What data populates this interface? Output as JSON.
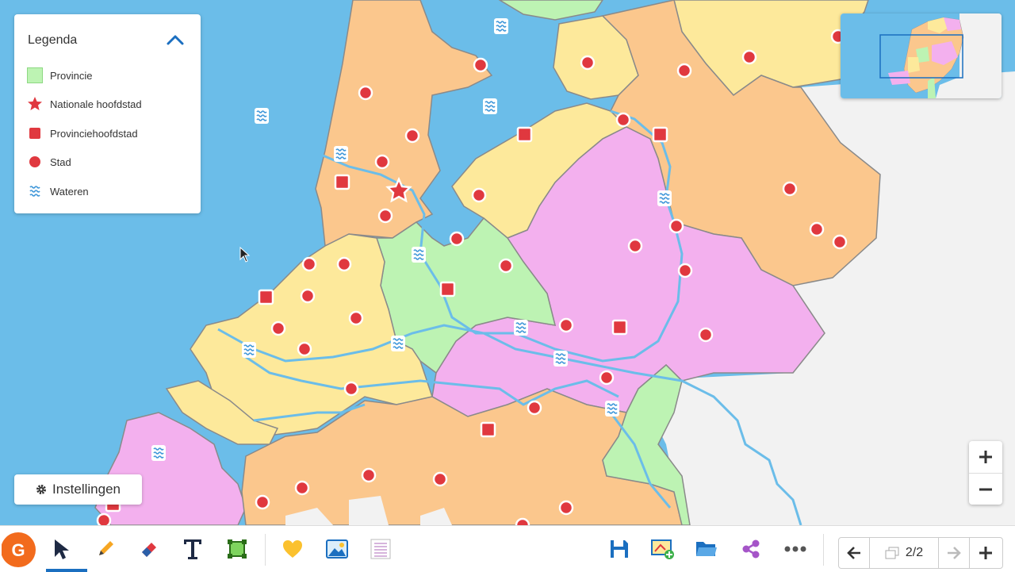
{
  "legend": {
    "title": "Legenda",
    "items": [
      {
        "label": "Provincie",
        "icon": "province-swatch-icon"
      },
      {
        "label": "Nationale hoofdstad",
        "icon": "star-icon"
      },
      {
        "label": "Provinciehoofdstad",
        "icon": "square-icon"
      },
      {
        "label": "Stad",
        "icon": "circle-icon"
      },
      {
        "label": "Wateren",
        "icon": "waves-icon"
      }
    ]
  },
  "settings": {
    "label": "Instellingen",
    "icon": "gear-icon"
  },
  "pager": {
    "current": "2/2"
  },
  "toolbar": {
    "tools": [
      "logo-icon",
      "pointer-icon",
      "pencil-icon",
      "eraser-icon",
      "text-icon",
      "shape-icon"
    ],
    "inserts": [
      "sticker-icon",
      "image-icon",
      "list-icon"
    ],
    "actions": [
      "save-icon",
      "add-map-icon",
      "folder-icon",
      "share-icon",
      "more-icon"
    ]
  },
  "colors": {
    "sea": "#6bbde9",
    "land_outside": "#f2f2f2",
    "orange": "#fbc78d",
    "yellow": "#fde99b",
    "green": "#bdf3b3",
    "pink": "#f3b0ee",
    "marker": "#e0383f",
    "water_icon": "#3a94d8",
    "accent": "#1b6fc0"
  }
}
